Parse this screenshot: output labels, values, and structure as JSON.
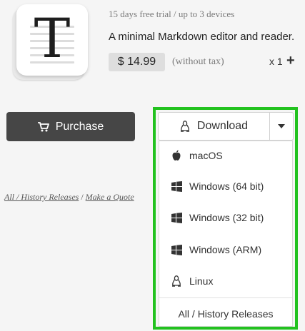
{
  "product": {
    "trial": "15 days free trial / up to 3 devices",
    "tagline": "A minimal Markdown editor and reader.",
    "price": "$ 14.99",
    "tax_note": "(without tax)",
    "quantity": "x 1",
    "add_symbol": "+",
    "icon_glyph": "T"
  },
  "purchase": {
    "label": "Purchase"
  },
  "links": {
    "history": "All / History Releases",
    "separator": " / ",
    "quote": "Make a Quote",
    "tail": "Q"
  },
  "download": {
    "label": "Download",
    "menu": [
      {
        "label": "macOS",
        "icon": "apple-icon"
      },
      {
        "label": "Windows (64 bit)",
        "icon": "windows-icon"
      },
      {
        "label": "Windows (32 bit)",
        "icon": "windows-icon"
      },
      {
        "label": "Windows (ARM)",
        "icon": "windows-icon"
      },
      {
        "label": "Linux",
        "icon": "linux-icon"
      }
    ],
    "history": "All / History Releases"
  },
  "colors": {
    "highlight": "#22c21f",
    "purchase_bg": "#464646"
  }
}
